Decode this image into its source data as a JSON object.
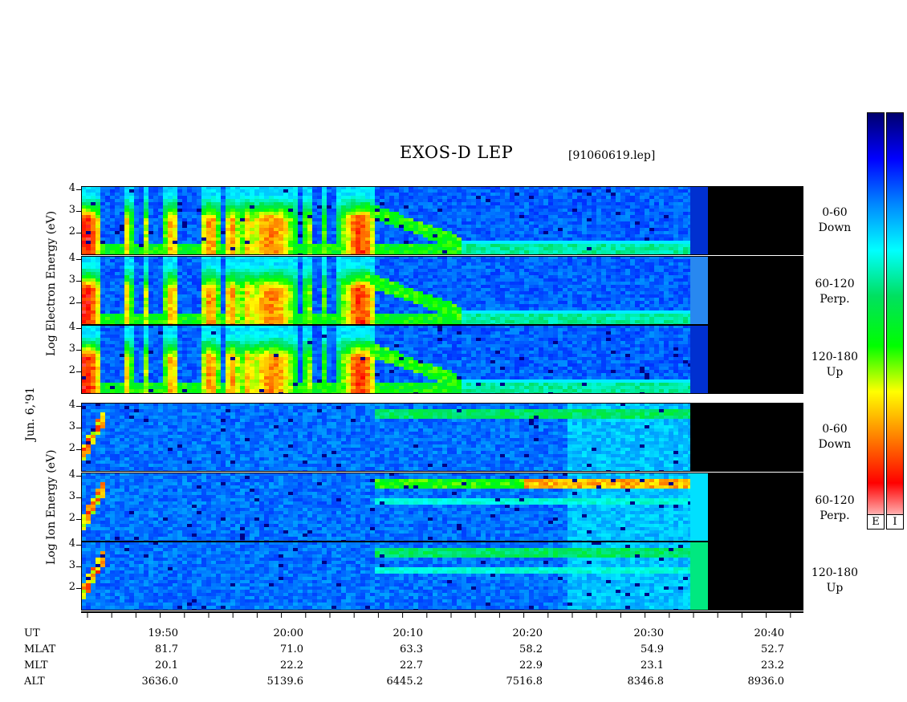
{
  "header": {
    "title": "EXOS-D LEP",
    "file": "[91060619.lep]"
  },
  "y_ticks": [
    "4",
    "3",
    "2"
  ],
  "left_labels": {
    "electron": [
      "Log",
      "Electron",
      "Energy",
      "(eV)"
    ],
    "date": "Jun. 6,'91",
    "ion": [
      "Log",
      "Ion",
      "Energy",
      "(eV)"
    ]
  },
  "pitch_labels": [
    {
      "range": "0-60",
      "dir": "Down"
    },
    {
      "range": "60-120",
      "dir": "Perp."
    },
    {
      "range": "120-180",
      "dir": "Up"
    },
    {
      "range": "0-60",
      "dir": "Down"
    },
    {
      "range": "60-120",
      "dir": "Perp."
    },
    {
      "range": "120-180",
      "dir": "Up"
    }
  ],
  "colorbar": {
    "electron_label": "E",
    "ion_label": "I",
    "colors": [
      "#00006e",
      "#0000ff",
      "#0088ff",
      "#00ffff",
      "#00e060",
      "#00ff00",
      "#ffff00",
      "#ff8000",
      "#ff0000",
      "#ffffff"
    ]
  },
  "footer": {
    "row_labels": [
      "UT",
      "MLAT",
      "MLT",
      "ALT"
    ],
    "ut": [
      "19:50",
      "20:00",
      "20:10",
      "20:20",
      "20:30",
      "20:40"
    ],
    "mlat": [
      "81.7",
      "71.0",
      "63.3",
      "58.2",
      "54.9",
      "52.7"
    ],
    "mlt": [
      "20.1",
      "22.2",
      "22.7",
      "22.9",
      "23.1",
      "23.2"
    ],
    "alt": [
      "3636.0",
      "5139.6",
      "6445.2",
      "7516.8",
      "8346.8",
      "8936.0"
    ]
  },
  "chart_data": {
    "type": "heatmap",
    "title": "EXOS-D LEP",
    "xlabel": "UT",
    "ylabel": "Log Energy (eV)",
    "ylim": [
      1,
      4.2
    ],
    "x_range": [
      "19:43",
      "20:43"
    ],
    "data_end": "20:35",
    "panels": [
      {
        "species": "Electron",
        "pitch": "0-60 Down"
      },
      {
        "species": "Electron",
        "pitch": "60-120 Perp."
      },
      {
        "species": "Electron",
        "pitch": "120-180 Up"
      },
      {
        "species": "Ion",
        "pitch": "0-60 Down"
      },
      {
        "species": "Ion",
        "pitch": "60-120 Perp."
      },
      {
        "species": "Ion",
        "pitch": "120-180 Up"
      }
    ]
  }
}
